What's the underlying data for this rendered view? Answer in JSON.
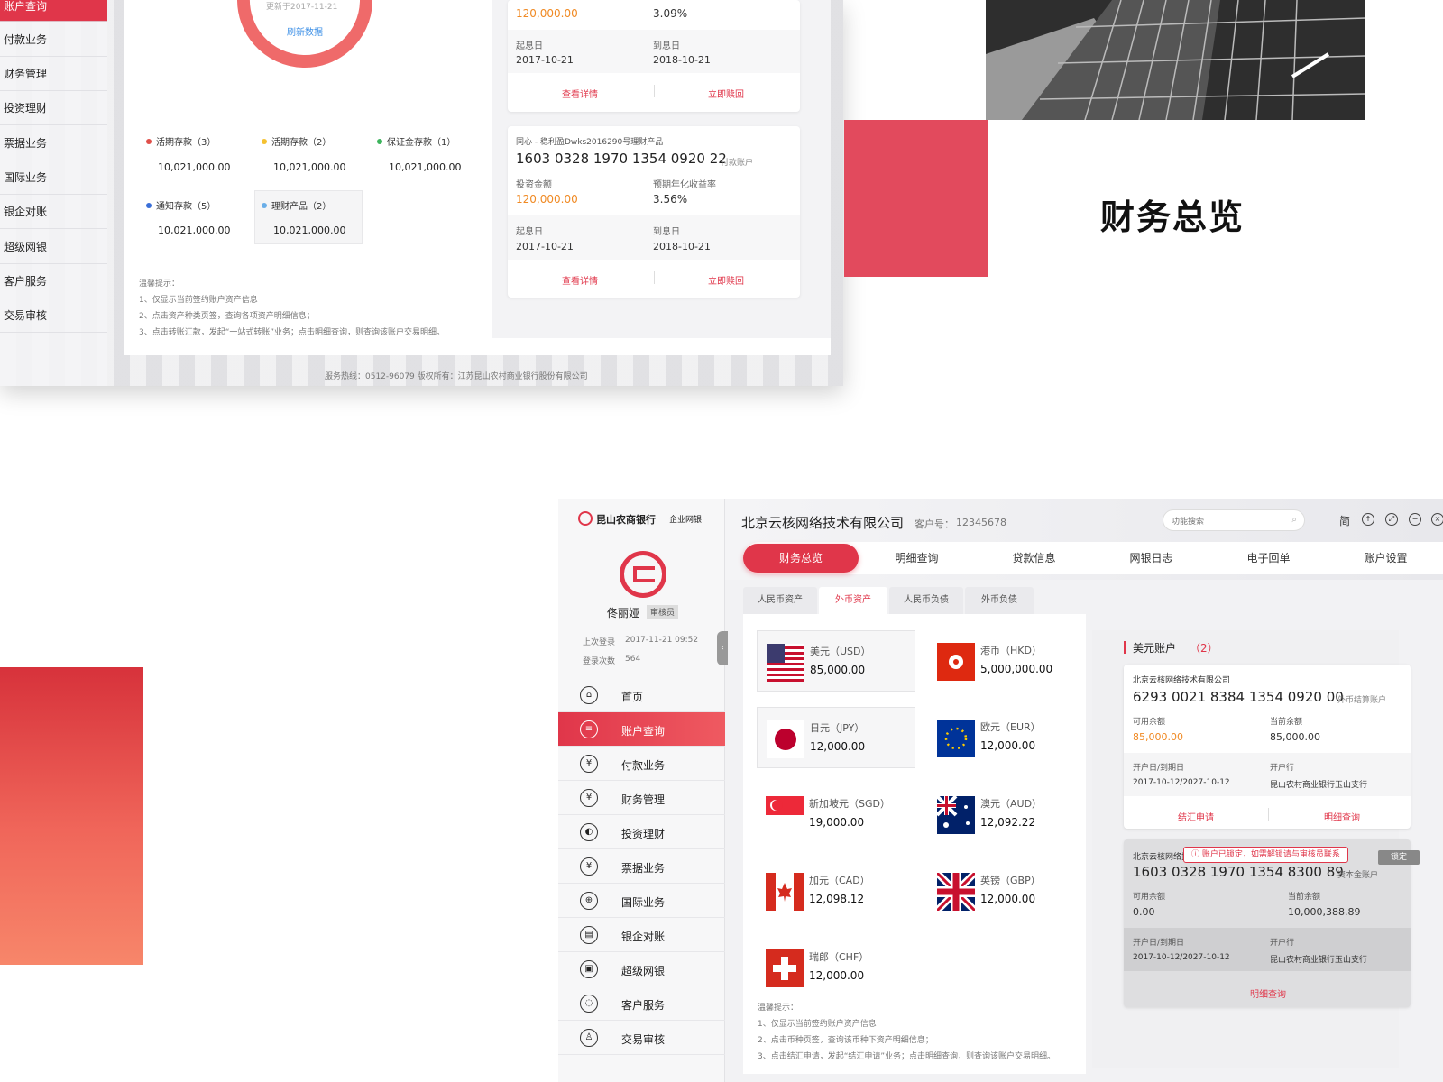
{
  "top_sidebar": [
    "账户查询",
    "付款业务",
    "财务管理",
    "投资理财",
    "票据业务",
    "国际业务",
    "银企对账",
    "超级网银",
    "客户服务",
    "交易审核"
  ],
  "donut": {
    "updated": "更新于2017-11-21",
    "refresh": "刷新数据"
  },
  "legend": [
    {
      "label": "活期存款（3）",
      "value": "10,021,000.00",
      "color": "#e0504a"
    },
    {
      "label": "活期存款（2）",
      "value": "10,021,000.00",
      "color": "#f5c131"
    },
    {
      "label": "保证金存款（1）",
      "value": "10,021,000.00",
      "color": "#3cb45c"
    },
    {
      "label": "通知存款（5）",
      "value": "10,021,000.00",
      "color": "#3a6fd8"
    },
    {
      "label": "理财产品（2）",
      "value": "10,021,000.00",
      "color": "#6aaee8"
    }
  ],
  "top_tips": {
    "title": "温馨提示：",
    "l1": "1、仅显示当前签约账户资产信息",
    "l2": "2、点击资产种类页签，查询各项资产明细信息；",
    "l3": "3、点击转账汇款，发起“一站式转账”业务；点击明细查询，则查询该账户交易明细。"
  },
  "top_footer": "服务热线：0512-96079    版权所有：江苏昆山农村商业银行股份有限公司",
  "product1": {
    "amount": "120,000.00",
    "rate": "3.09%",
    "start_label": "起息日",
    "start": "2017-10-21",
    "end_label": "到息日",
    "end": "2018-10-21",
    "detail": "查看详情",
    "redeem": "立即赎回"
  },
  "product2": {
    "name": "同心 - 稳利盈Dwks2016290号理财产品",
    "account": "1603 0328 1970 1354 0920 22",
    "account_type": "付款账户",
    "amount_label": "投资金额",
    "amount": "120,000.00",
    "rate_label": "预期年化收益率",
    "rate": "3.56%",
    "start_label": "起息日",
    "start": "2017-10-21",
    "end_label": "到息日",
    "end": "2018-10-21",
    "detail": "查看详情",
    "redeem": "立即赎回"
  },
  "overview_title": "财务总览",
  "bank": {
    "name": "昆山农商银行",
    "sub": "企业网银"
  },
  "user": {
    "name": "佟丽娅",
    "role": "审核员",
    "last_login_label": "上次登录",
    "last_login": "2017-11-21 09:52",
    "count_label": "登录次数",
    "count": "564"
  },
  "nav": [
    {
      "label": "首页",
      "icon": "⌂"
    },
    {
      "label": "账户查询",
      "icon": "≡"
    },
    {
      "label": "付款业务",
      "icon": "¥"
    },
    {
      "label": "财务管理",
      "icon": "¥"
    },
    {
      "label": "投资理财",
      "icon": "◐"
    },
    {
      "label": "票据业务",
      "icon": "¥"
    },
    {
      "label": "国际业务",
      "icon": "⊕"
    },
    {
      "label": "银企对账",
      "icon": "▤"
    },
    {
      "label": "超级网银",
      "icon": "▣"
    },
    {
      "label": "客户服务",
      "icon": "◌"
    },
    {
      "label": "交易审核",
      "icon": "♙"
    }
  ],
  "company": {
    "name": "北京云核网络技术有限公司",
    "cust_label": "客户号：",
    "cust_no": "12345678"
  },
  "search_placeholder": "功能搜索",
  "win_simplified": "简",
  "tabs": [
    "财务总览",
    "明细查询",
    "贷款信息",
    "网银日志",
    "电子回单",
    "账户设置"
  ],
  "subtabs": [
    "人民币资产",
    "外币资产",
    "人民币负债",
    "外币负债"
  ],
  "currencies": [
    {
      "name": "美元（USD）",
      "amount": "85,000.00",
      "flag": "usd"
    },
    {
      "name": "港币（HKD）",
      "amount": "5,000,000.00",
      "flag": "hkd"
    },
    {
      "name": "日元（JPY）",
      "amount": "12,000.00",
      "flag": "jpy"
    },
    {
      "name": "欧元（EUR）",
      "amount": "12,000.00",
      "flag": "eur"
    },
    {
      "name": "新加坡元（SGD）",
      "amount": "19,000.00",
      "flag": "sgd"
    },
    {
      "name": "澳元（AUD）",
      "amount": "12,092.22",
      "flag": "aud"
    },
    {
      "name": "加元（CAD）",
      "amount": "12,098.12",
      "flag": "cad"
    },
    {
      "name": "英镑（GBP）",
      "amount": "12,000.00",
      "flag": "gbp"
    },
    {
      "name": "瑞郎（CHF）",
      "amount": "12,000.00",
      "flag": "chf"
    }
  ],
  "bot_tips": {
    "title": "温馨提示：",
    "l1": "1、仅显示当前签约账户资产信息",
    "l2": "2、点击币种页签，查询该币种下资产明细信息；",
    "l3": "3、点击结汇申请，发起“结汇申请”业务；点击明细查询，则查询该账户交易明细。"
  },
  "usd_accounts": {
    "title": "美元账户",
    "count": "（2）"
  },
  "acct1": {
    "company": "北京云核网络技术有限公司",
    "number": "6293 0021 8384 1354 0920 00",
    "type": "外币结算账户",
    "avail_label": "可用余额",
    "avail": "85,000.00",
    "bal_label": "当前余额",
    "bal": "85,000.00",
    "date_label": "开户日/到期日",
    "dates": "2017-10-12/2027-10-12",
    "bank_label": "开户行",
    "bank": "昆山农村商业银行玉山支行",
    "action1": "结汇申请",
    "action2": "明细查询"
  },
  "acct2": {
    "company": "北京云核网络技术有限公司",
    "number": "1603 0328 1970 1354 8300 89",
    "type": "资本金账户",
    "avail_label": "可用余额",
    "avail": "0.00",
    "bal_label": "当前余额",
    "bal": "10,000,388.89",
    "date_label": "开户日/到期日",
    "dates": "2017-10-12/2027-10-12",
    "bank_label": "开户行",
    "bank": "昆山农村商业银行玉山支行",
    "action": "明细查询",
    "lock_tip": "账户已锁定，如需解锁请与审核员联系",
    "lock_badge": "锁定"
  },
  "colors": {
    "brand": "#e0364a",
    "orange": "#f08a24"
  }
}
